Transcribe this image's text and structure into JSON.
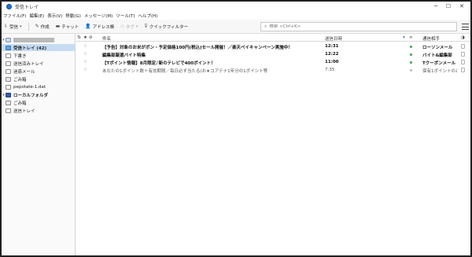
{
  "window": {
    "title": "受信トレイ",
    "minimize": "─",
    "maximize": "☐",
    "close": "✕"
  },
  "menu": [
    {
      "label": "ファイル(F)"
    },
    {
      "label": "編集(E)"
    },
    {
      "label": "表示(V)"
    },
    {
      "label": "移動(G)"
    },
    {
      "label": "メッセージ(M)"
    },
    {
      "label": "ツール(T)"
    },
    {
      "label": "ヘルプ(H)"
    }
  ],
  "toolbar": {
    "receive": {
      "icon": "⇩",
      "label": "受信",
      "arrow": "▾"
    },
    "compose": {
      "icon": "✎",
      "label": "作成"
    },
    "chat": {
      "icon": "▬",
      "label": "チャット"
    },
    "addressbook": {
      "icon": "👤",
      "label": "アドレス帳"
    },
    "tag": {
      "icon": "◇",
      "label": "タグ",
      "arrow": "▾"
    },
    "quickfilter": {
      "icon": "⊽",
      "label": "クイックフィルター"
    },
    "search_placeholder": "検索 <Ctrl+K>",
    "search_icon": "⌕"
  },
  "folders": [
    {
      "label": "",
      "kind": "account"
    },
    {
      "label": "受信トレイ (42)",
      "kind": "inbox",
      "selected": true
    },
    {
      "label": "下書き",
      "kind": "folder"
    },
    {
      "label": "送信済みトレイ",
      "kind": "folder"
    },
    {
      "label": "迷惑メール",
      "kind": "folder"
    },
    {
      "label": "ごみ箱",
      "kind": "trash"
    },
    {
      "label": "pepotate-1.dat",
      "kind": "folder"
    },
    {
      "label": "ローカルフォルダ",
      "kind": "local"
    },
    {
      "label": "ごみ箱",
      "kind": "trash"
    },
    {
      "label": "送信トレイ",
      "kind": "folder"
    }
  ],
  "columns": {
    "thread_icon": "⇅",
    "star_icon": "★",
    "attach_icon": "⊘",
    "subject": "件名",
    "date": "送信日時",
    "status_icon": "▾",
    "junk_icon": "∞",
    "from": "通信相手",
    "options_icon": "◑"
  },
  "messages": [
    {
      "subject": "【予告】対象のお米がポン・予定価格100円(税込)セール開催！／楽天ペイキャンペーン実施中！",
      "date": "12:31",
      "from": "ローソンメール",
      "unread": true
    },
    {
      "subject": "編集部厳選バイト特集",
      "date": "12:22",
      "from": "バイト&編集部",
      "unread": true
    },
    {
      "subject": "【Tポイント情報】8月限定♪新のテレビで400ポイント！",
      "date": "11:00",
      "from": "Tクーポンメール",
      "unread": true
    },
    {
      "subject": "あなたの1ポイント数＋有効期限／毎日必ず当たる(お★コアテナ1年分の1ポイント等",
      "date": "7:35",
      "from": "保有1ポイントのお…",
      "unread": false
    }
  ]
}
